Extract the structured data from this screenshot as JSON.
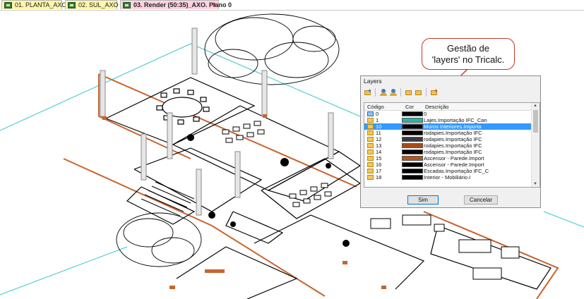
{
  "tabs": [
    {
      "label": "01. PLANTA_AXO",
      "active": false
    },
    {
      "label": "02. SUL_AXO",
      "active": false
    },
    {
      "label": "03. Render (50:35)_AXO. Plano 0",
      "active": true
    }
  ],
  "tab_close_glyph": "×",
  "callout": {
    "line1": "Gestão de",
    "line2": "'layers' no Tricalc."
  },
  "dialog": {
    "title": "Layers",
    "columns": {
      "code": "Código",
      "color": "Cor",
      "description": "Descrição"
    },
    "rows": [
      {
        "code": "0",
        "color": "#000000",
        "description": "0",
        "selected": false,
        "open": true
      },
      {
        "code": "1",
        "color": "#2ab3a8",
        "description": "Lajes.Importação IFC_Can",
        "selected": false,
        "open": false
      },
      {
        "code": "10",
        "color": "#000000",
        "description": "Muros Interiores.Importa",
        "selected": true,
        "open": false
      },
      {
        "code": "11",
        "color": "#000000",
        "description": "rodapies.Importação IFC",
        "selected": false,
        "open": false
      },
      {
        "code": "12",
        "color": "#3a3a3a",
        "description": "rodapies.Importação IFC",
        "selected": false,
        "open": false
      },
      {
        "code": "13",
        "color": "#a84a1c",
        "description": "rodapies.Importação IFC",
        "selected": false,
        "open": false
      },
      {
        "code": "14",
        "color": "#000000",
        "description": "rodapies.Importação IFC",
        "selected": false,
        "open": false
      },
      {
        "code": "15",
        "color": "#b3561f",
        "description": "Ascensor - Parede.Import",
        "selected": false,
        "open": false
      },
      {
        "code": "16",
        "color": "#000000",
        "description": "Ascensor - Parede.Import",
        "selected": false,
        "open": false
      },
      {
        "code": "17",
        "color": "#000000",
        "description": "Escadas.Importação IFC_C",
        "selected": false,
        "open": false
      },
      {
        "code": "18",
        "color": "#000000",
        "description": "Interior - Mobiliário.I",
        "selected": false,
        "open": false
      }
    ],
    "ok_label": "Sim",
    "cancel_label": "Cancelar"
  },
  "colors": {
    "slab_edge": "#c8642d",
    "guide_line": "#36c8c8",
    "column": "#8a8a8a",
    "callout_border": "#c0392b"
  }
}
